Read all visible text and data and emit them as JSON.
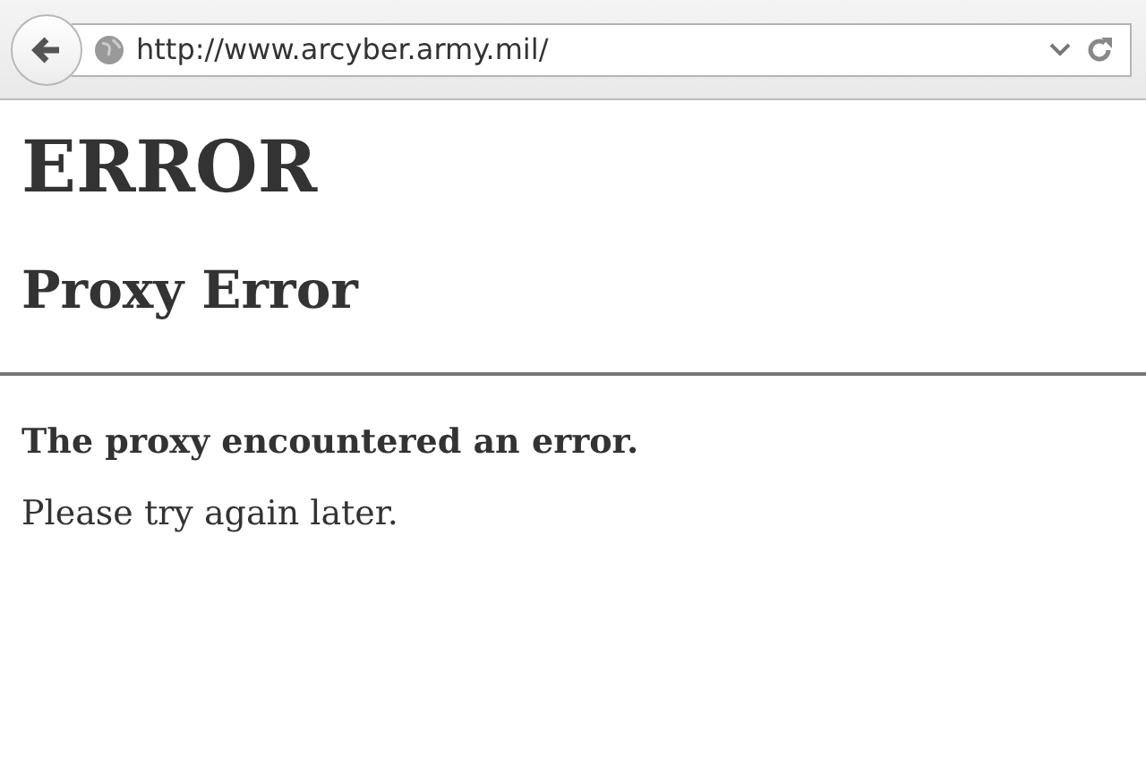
{
  "browser": {
    "url": "http://www.arcyber.army.mil/"
  },
  "page": {
    "heading": "ERROR",
    "subheading": "Proxy Error",
    "message": "The proxy encountered an error.",
    "note": "Please try again later."
  }
}
